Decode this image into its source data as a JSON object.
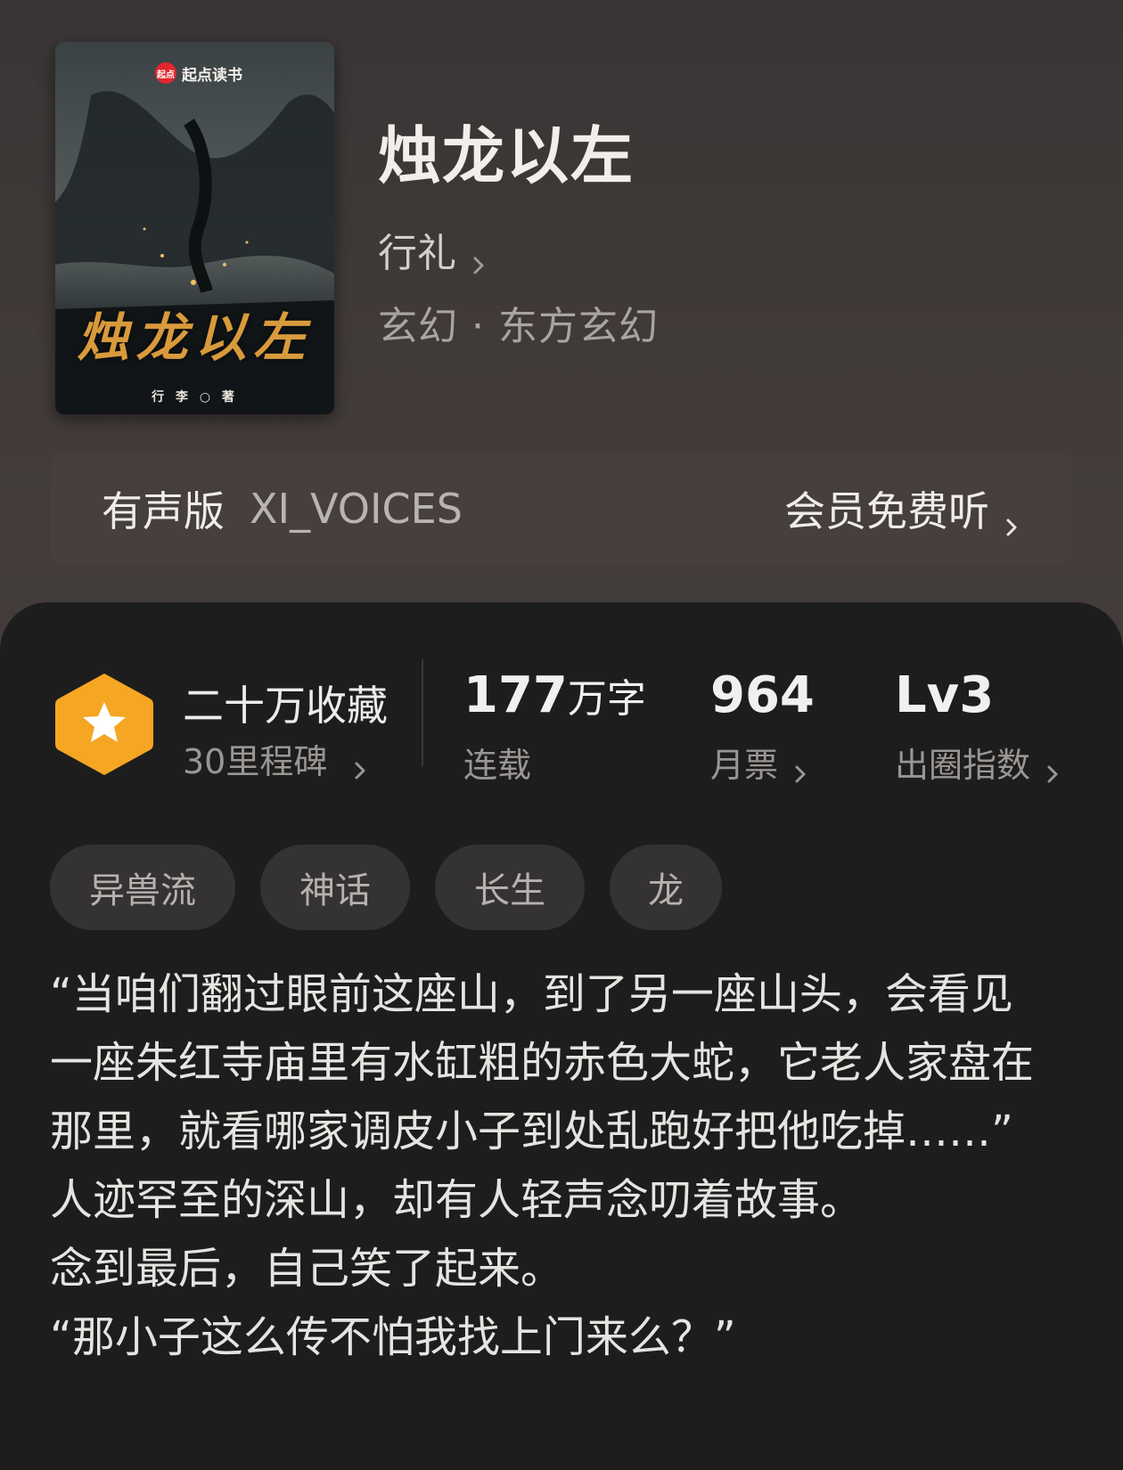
{
  "book": {
    "title": "烛龙以左",
    "author": "行礼",
    "genre": "玄幻 · 东方玄幻"
  },
  "cover": {
    "logo_badge": "起点",
    "logo_text": "起点读书",
    "title": "烛龙以左",
    "author_line": "行 李 ○ 著"
  },
  "audio": {
    "label": "有声版",
    "voice": "XI_VOICES",
    "action": "会员免费听"
  },
  "stats": {
    "collections": "二十万收藏",
    "milestone": "30里程碑",
    "word_count_num": "177",
    "word_count_unit": "万字",
    "status": "连载",
    "monthly_votes": "964",
    "monthly_votes_label": "月票",
    "level": "Lv3",
    "level_label": "出圈指数"
  },
  "tags": [
    "异兽流",
    "神话",
    "长生",
    "龙"
  ],
  "description": [
    "“当咱们翻过眼前这座山，到了另一座山头，会看见一座朱红寺庙里有水缸粗的赤色大蛇，它老人家盘在那里，就看哪家调皮小子到处乱跑好把他吃掉……”",
    "人迹罕至的深山，却有人轻声念叨着故事。",
    "念到最后，自己笑了起来。",
    "“那小子这么传不怕我找上门来么？”"
  ],
  "colors": {
    "badge": "#f5a623",
    "sheet": "#1e1d1d",
    "header": "#3c3634"
  }
}
